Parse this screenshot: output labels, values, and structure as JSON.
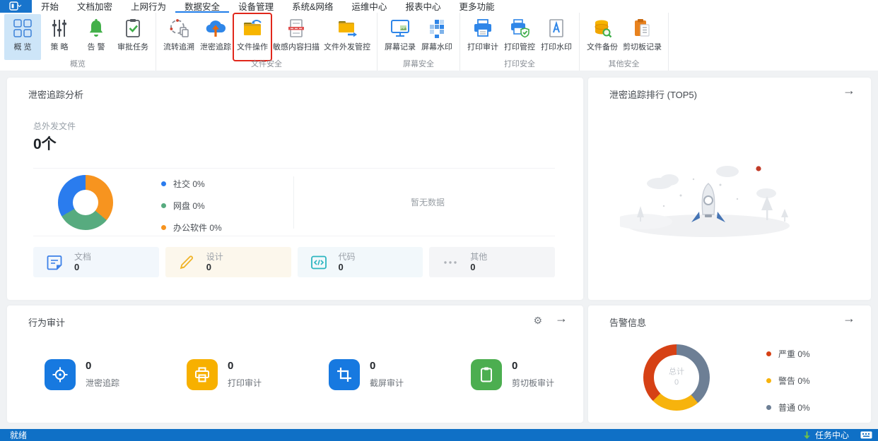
{
  "menubar": {
    "items": [
      {
        "label": "开始"
      },
      {
        "label": "文档加密"
      },
      {
        "label": "上网行为"
      },
      {
        "label": "数据安全",
        "active": true
      },
      {
        "label": "设备管理"
      },
      {
        "label": "系统&网络"
      },
      {
        "label": "运维中心"
      },
      {
        "label": "报表中心"
      },
      {
        "label": "更多功能"
      }
    ]
  },
  "ribbon": {
    "groups": [
      {
        "label": "概览",
        "items": [
          {
            "label": "概 览",
            "selected": true
          },
          {
            "label": "策 略"
          },
          {
            "label": "告 警"
          },
          {
            "label": "审批任务"
          }
        ]
      },
      {
        "label": "文件安全",
        "items": [
          {
            "label": "流转追溯"
          },
          {
            "label": "泄密追踪"
          },
          {
            "label": "文件操作",
            "highlighted": true
          },
          {
            "label": "敏感内容扫描"
          },
          {
            "label": "文件外发管控"
          }
        ]
      },
      {
        "label": "屏幕安全",
        "items": [
          {
            "label": "屏幕记录"
          },
          {
            "label": "屏幕水印"
          }
        ]
      },
      {
        "label": "打印安全",
        "items": [
          {
            "label": "打印审计"
          },
          {
            "label": "打印管控"
          },
          {
            "label": "打印水印"
          }
        ]
      },
      {
        "label": "其他安全",
        "items": [
          {
            "label": "文件备份"
          },
          {
            "label": "剪切板记录"
          }
        ]
      }
    ]
  },
  "leak_analysis": {
    "title": "泄密追踪分析",
    "total_label": "总外发文件",
    "total_value": "0个",
    "legend": [
      {
        "label": "社交",
        "percent": "0%",
        "color": "#2a7cee"
      },
      {
        "label": "网盘",
        "percent": "0%",
        "color": "#57ab7f"
      },
      {
        "label": "办公软件",
        "percent": "0%",
        "color": "#f7941f"
      }
    ],
    "empty_text": "暂无数据",
    "cards": [
      {
        "label": "文档",
        "value": "0"
      },
      {
        "label": "设计",
        "value": "0"
      },
      {
        "label": "代码",
        "value": "0"
      },
      {
        "label": "其他",
        "value": "0"
      }
    ]
  },
  "leak_rank": {
    "title": "泄密追踪排行 (TOP5)"
  },
  "behavior_audit": {
    "title": "行为审计",
    "items": [
      {
        "value": "0",
        "label": "泄密追踪",
        "color": "#1779e0"
      },
      {
        "value": "0",
        "label": "打印审计",
        "color": "#f7b000"
      },
      {
        "value": "0",
        "label": "截屏审计",
        "color": "#1779e0"
      },
      {
        "value": "0",
        "label": "剪切板审计",
        "color": "#4cae50"
      }
    ]
  },
  "alert_info": {
    "title": "告警信息",
    "center_label": "总计",
    "center_value": "0",
    "legend": [
      {
        "label": "严重",
        "percent": "0%",
        "color": "#d64115"
      },
      {
        "label": "警告",
        "percent": "0%",
        "color": "#f7b30d"
      },
      {
        "label": "普通",
        "percent": "0%",
        "color": "#6d7f95"
      }
    ]
  },
  "statusbar": {
    "status": "就绪",
    "task_center": "任务中心"
  },
  "icons": {
    "arrow_right": "→",
    "gear": "⚙"
  },
  "chart_data": [
    {
      "type": "pie",
      "title": "泄密追踪分析 外发渠道占比",
      "labels": [
        "社交",
        "网盘",
        "办公软件"
      ],
      "values": [
        0,
        0,
        0
      ],
      "display_percents": [
        "0%",
        "0%",
        "0%"
      ],
      "colors": [
        "#2a7cee",
        "#57ab7f",
        "#f7941f"
      ],
      "legend_position": "right",
      "donut": true
    },
    {
      "type": "pie",
      "title": "告警信息",
      "labels": [
        "严重",
        "警告",
        "普通"
      ],
      "values": [
        0,
        0,
        0
      ],
      "display_percents": [
        "0%",
        "0%",
        "0%"
      ],
      "colors": [
        "#d64115",
        "#f7b30d",
        "#6d7f95"
      ],
      "center_label": "总计",
      "center_value": 0,
      "legend_position": "right",
      "donut": true
    }
  ]
}
